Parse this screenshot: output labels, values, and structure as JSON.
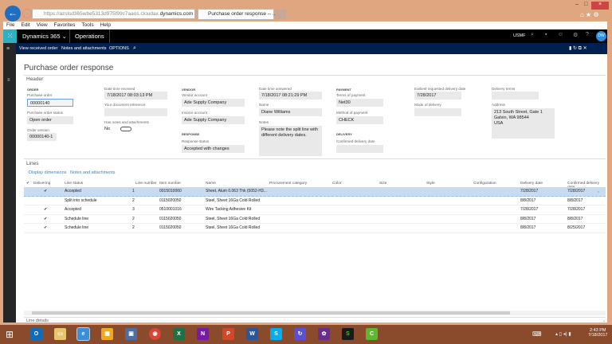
{
  "browser": {
    "url_prefix": "https://azslsd365wbe5313d975f99c7aaos.cloudax.",
    "url_domain": "dynamics.com",
    "tab_title": "Purchase order response -- ...",
    "menu": [
      "File",
      "Edit",
      "View",
      "Favorites",
      "Tools",
      "Help"
    ]
  },
  "appbar": {
    "product": "Dynamics 365",
    "module": "Operations",
    "company": "USMF",
    "user_initials": "DW"
  },
  "actionbar": {
    "items": [
      "View received order",
      "Notes and attachments",
      "OPTIONS"
    ]
  },
  "page": {
    "title": "Purchase order response",
    "header_label": "Header"
  },
  "header": {
    "order_section": "ORDER",
    "purchase_order_label": "Purchase order",
    "purchase_order": "00000140",
    "po_status_label": "Purchase order status",
    "po_status": "Open order",
    "order_version_label": "Order version",
    "order_version": "00000140-1",
    "dt_received_label": "Date time received",
    "dt_received": "7/18/2017 08:03:13 PM",
    "doc_ref_label": "Your document reference",
    "doc_ref": "",
    "has_notes_label": "Has notes and attachments",
    "has_notes": "No",
    "vendor_section": "VENDOR",
    "vendor_account_label": "Vendor account",
    "vendor_account": "Ade Supply Company",
    "invoice_account_label": "Invoice account",
    "invoice_account": "Ade Supply Company",
    "response_section": "RESPONSE",
    "response_status_label": "Response status",
    "response_status": "Accepted with changes",
    "dt_answered_label": "Date time answered",
    "dt_answered": "7/18/2017 08:21:29 PM",
    "name_label": "Name",
    "name": "Diane Williams",
    "notes_label": "Notes",
    "notes": "Please note the split line with different delivery dates.",
    "payment_section": "PAYMENT",
    "terms_label": "Terms of payment",
    "terms": "Net30",
    "method_label": "Method of payment",
    "method": "CHECK",
    "delivery_section": "DELIVERY",
    "confirmed_date_label": "Confirmed delivery date",
    "confirmed_date": "",
    "earliest_label": "Earliest requested delivery date",
    "earliest": "7/28/2017",
    "mode_label": "Mode of delivery",
    "mode": "",
    "terms_delivery_label": "Delivery terms",
    "terms_delivery": "",
    "address_label": "Address",
    "address": "213 South Street, Gate 1\nGalvin, WA 98544\nUSA"
  },
  "lines": {
    "label": "Lines",
    "actions": [
      "Display dimensions",
      "Notes and attachments"
    ],
    "columns": [
      "Delivering",
      "Line status",
      "Line number",
      "Item number",
      "Name",
      "Procurement category",
      "Color",
      "Size",
      "Style",
      "Configuration",
      "Delivery date",
      "Confirmed delivery date"
    ],
    "rows": [
      {
        "delivering": "✔",
        "status": "Accepted",
        "line": "1",
        "item": "0015010060",
        "name": "Sheet, Alum 0.063 Thk (5052-H3...",
        "delivery": "7/28/2017",
        "confirmed": "7/28/2017"
      },
      {
        "delivering": "",
        "status": "Split into schedule",
        "line": "2",
        "item": "0115020050",
        "name": "Steel, Sheet 16Ga Cold Rolled",
        "delivery": "8/8/2017",
        "confirmed": "8/8/2017"
      },
      {
        "delivering": "✔",
        "status": "Accepted",
        "line": "3",
        "item": "0510001016",
        "name": "Wire Tacking Adhesive Kit",
        "delivery": "7/28/2017",
        "confirmed": "7/28/2017"
      },
      {
        "delivering": "✔",
        "status": "Schedule line",
        "line": "2",
        "item": "0115020050",
        "name": "Steel, Sheet 16Ga Cold Rolled",
        "delivery": "8/8/2017",
        "confirmed": "8/8/2017"
      },
      {
        "delivering": "✔",
        "status": "Schedule line",
        "line": "2",
        "item": "0115020050",
        "name": "Steel, Sheet 16Ga Cold Rolled",
        "delivery": "8/8/2017",
        "confirmed": "8/25/2017"
      }
    ]
  },
  "line_details": "Line details",
  "taskbar": {
    "time": "2:43 PM",
    "date": "7/18/2017"
  }
}
